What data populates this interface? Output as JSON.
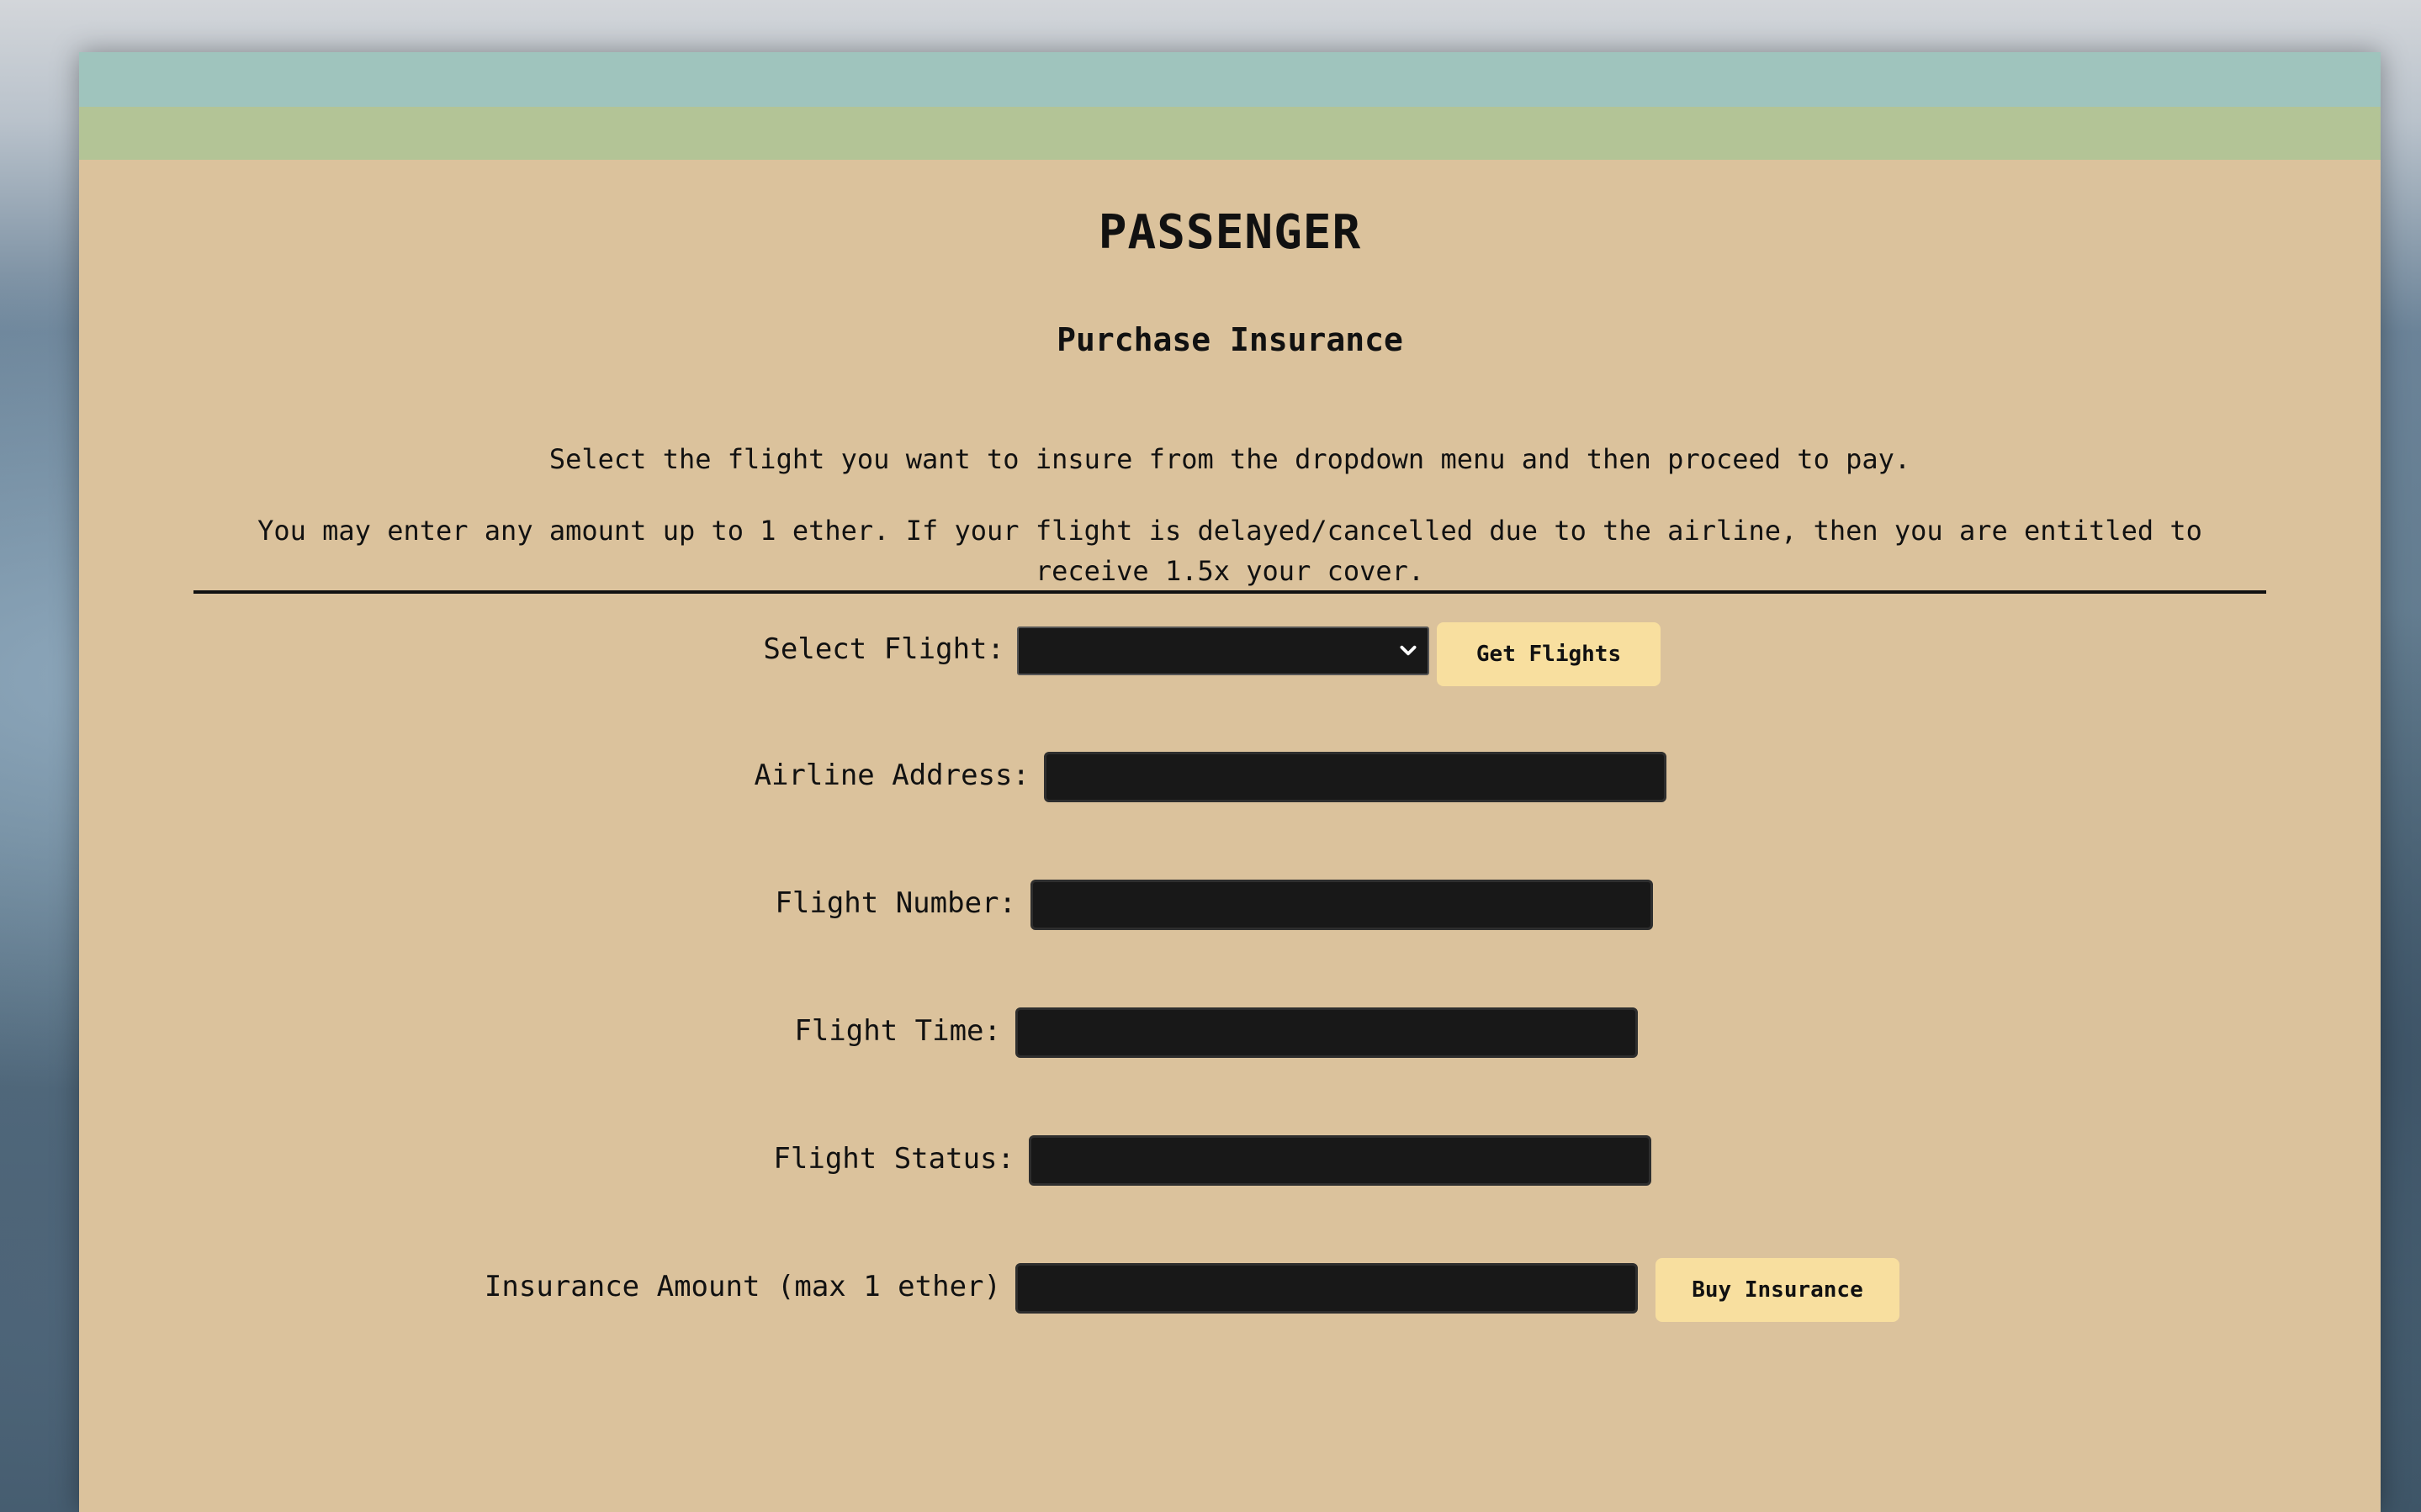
{
  "page": {
    "title": "PASSENGER",
    "subtitle": "Purchase Insurance",
    "intro_line1": "Select the flight you want to insure from the dropdown menu and then proceed to pay.",
    "intro_line2": "You may enter any amount up to 1 ether. If your flight is delayed/cancelled due to the airline, then you are entitled to receive 1.5x your cover."
  },
  "form": {
    "select_flight_label": "Select Flight:",
    "select_flight_value": "",
    "get_flights_label": "Get Flights",
    "airline_address_label": "Airline Address:",
    "airline_address_value": "",
    "flight_number_label": "Flight Number:",
    "flight_number_value": "",
    "flight_time_label": "Flight Time:",
    "flight_time_value": "",
    "flight_status_label": "Flight Status:",
    "flight_status_value": "",
    "insurance_amount_label": "Insurance Amount (max 1 ether)",
    "insurance_amount_value": "",
    "buy_insurance_label": "Buy Insurance"
  },
  "icons": {
    "select_arrow": "chevron-down-icon"
  },
  "colors": {
    "card_background": "#dbc29c",
    "top_band": "#9fc4bd",
    "second_band": "#b3c496",
    "field_background": "#181818",
    "button_background": "#f8df9f"
  }
}
